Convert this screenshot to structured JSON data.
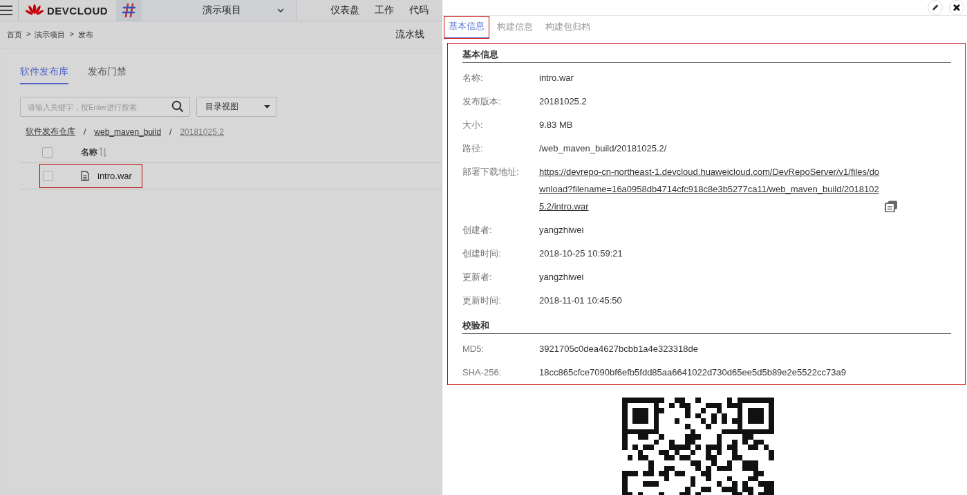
{
  "header": {
    "brand": "DEVCLOUD",
    "project": "演示项目",
    "nav": [
      "仪表盘",
      "工作",
      "代码"
    ]
  },
  "breadcrumb": {
    "items": [
      "首页",
      "演示项目",
      "发布"
    ],
    "separator": ">"
  },
  "subnav": "流水线",
  "tabs": [
    {
      "label": "软件发布库",
      "selected": true
    },
    {
      "label": "发布门禁",
      "selected": false
    }
  ],
  "search": {
    "placeholder": "请输入关键字，按Enter进行搜索"
  },
  "view_select": {
    "value": "目录视图"
  },
  "path": {
    "items": [
      "软件发布仓库",
      "web_maven_build",
      "20181025.2"
    ],
    "separator": "/"
  },
  "table": {
    "column": "名称",
    "header_checked": false,
    "rows": [
      {
        "name": "intro.war",
        "checked": false
      }
    ]
  },
  "drawer": {
    "tabs": [
      {
        "label": "基本信息",
        "selected": true
      },
      {
        "label": "构建信息",
        "selected": false
      },
      {
        "label": "构建包归档",
        "selected": false
      }
    ],
    "sections": [
      {
        "title": "基本信息",
        "fields": [
          {
            "label": "名称:",
            "value": "intro.war",
            "kind": "text"
          },
          {
            "label": "发布版本:",
            "value": "20181025.2",
            "kind": "text"
          },
          {
            "label": "大小:",
            "value": "9.83 MB",
            "kind": "text"
          },
          {
            "label": "路径:",
            "value": "/web_maven_build/20181025.2/",
            "kind": "text"
          },
          {
            "label": "部署下载地址:",
            "value": "https://devrepo-cn-northeast-1.devcloud.huaweicloud.com/DevRepoServer/v1/files/download?filename=16a0958db4714cfc918c8e3b5277ca11/web_maven_build/20181025.2/intro.war",
            "kind": "link"
          },
          {
            "label": "创建者:",
            "value": "yangzhiwei",
            "kind": "text"
          },
          {
            "label": "创建时间:",
            "value": "2018-10-25 10:59:21",
            "kind": "text"
          },
          {
            "label": "更新者:",
            "value": "yangzhiwei",
            "kind": "text"
          },
          {
            "label": "更新时间:",
            "value": "2018-11-01 10:45:50",
            "kind": "text"
          }
        ]
      },
      {
        "title": "校验和",
        "fields": [
          {
            "label": "MD5:",
            "value": "3921705c0dea4627bcbb1a4e323318de",
            "kind": "text"
          },
          {
            "label": "SHA-256:",
            "value": "18cc865cfce7090bf6efb5fdd85aa6641022d730d65ee5d5b89e2e5522cc73a9",
            "kind": "text"
          }
        ]
      }
    ]
  }
}
